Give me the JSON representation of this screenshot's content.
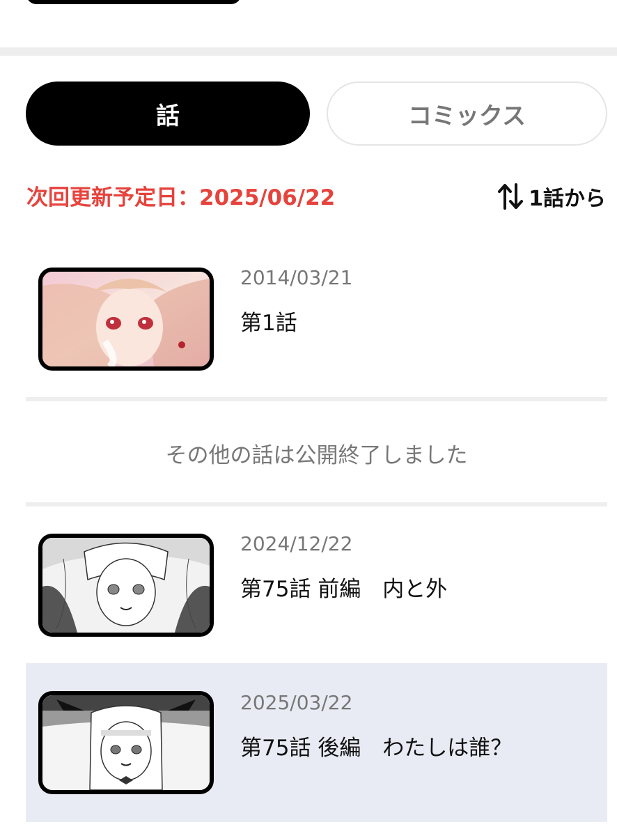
{
  "tabs": [
    {
      "label": "話",
      "active": true
    },
    {
      "label": "コミックス",
      "active": false
    }
  ],
  "schedule": {
    "next_update_label": "次回更新予定日：2025/06/22",
    "color": "#e5433c"
  },
  "sort": {
    "label": "1話から",
    "icon": "sort-arrows-icon"
  },
  "episodes_available": [
    {
      "date": "2014/03/21",
      "title": "第1話",
      "thumbnail": "color-illustration"
    }
  ],
  "ended_note": "その他の話は公開終了しました",
  "episodes_latest": [
    {
      "date": "2024/12/22",
      "title": "第75話 前編　内と外",
      "thumbnail": "monochrome-manga-panel"
    },
    {
      "date": "2025/03/22",
      "title": "第75話 後編　わたしは誰？",
      "thumbnail": "monochrome-manga-panel",
      "highlighted": true
    }
  ]
}
